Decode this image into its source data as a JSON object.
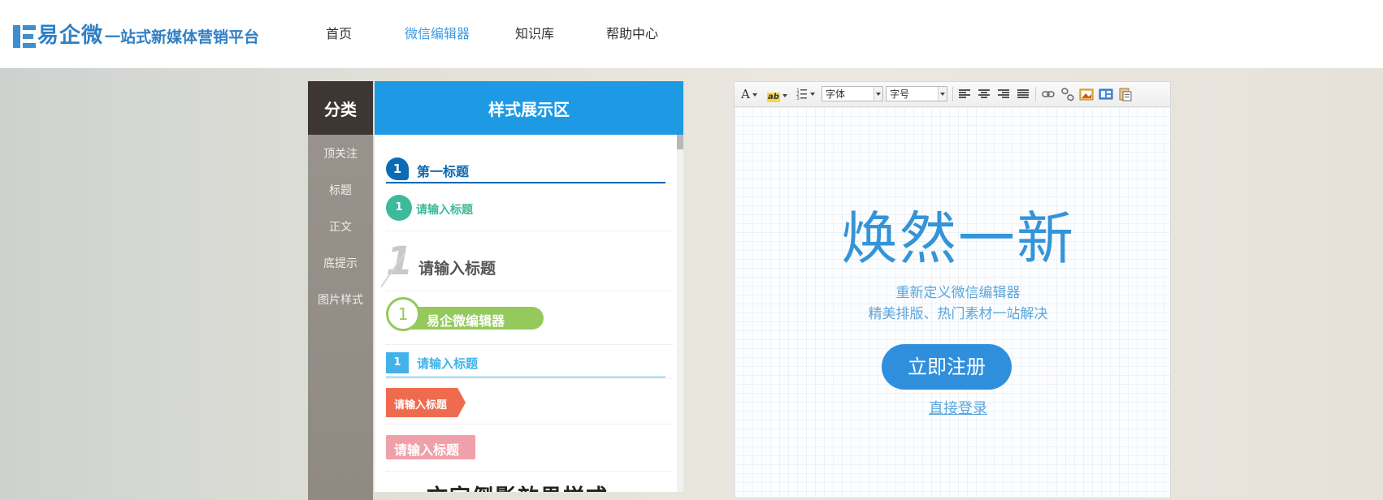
{
  "header": {
    "logo_name": "易企微",
    "logo_slogan": "一站式新媒体营销平台",
    "nav": [
      "首页",
      "微信编辑器",
      "知识库",
      "帮助中心"
    ],
    "active_nav": "微信编辑器"
  },
  "categories": {
    "title": "分类",
    "items": [
      "顶关注",
      "标题",
      "正文",
      "底提示",
      "图片样式"
    ]
  },
  "showcase": {
    "title": "样式展示区",
    "styles": [
      {
        "number": "1",
        "text": "第一标题"
      },
      {
        "number": "1",
        "text": "请输入标题"
      },
      {
        "number": "1",
        "text": "请输入标题"
      },
      {
        "number": "1",
        "text": "易企微编辑器"
      },
      {
        "number": "1",
        "text": "请输入标题"
      },
      {
        "text": "请输入标题"
      },
      {
        "text": "请输入标题"
      },
      {
        "text": "文字倒影效果样式"
      }
    ]
  },
  "editor": {
    "toolbar": {
      "font_color_label": "A",
      "highlight_label": "ab",
      "font_family_placeholder": "字体",
      "font_size_placeholder": "字号"
    },
    "hero_title": "焕然一新",
    "hero_line1": "重新定义微信编辑器",
    "hero_line2": "精美排版、热门素材一站解决",
    "register_label": "立即注册",
    "login_label": "直接登录"
  },
  "colors": {
    "brand": "#2e7fc4",
    "accent": "#1e9ae4",
    "category_header": "#3e3633",
    "register_button": "#2f8fdc"
  },
  "icons": [
    "logo-e-icon",
    "font-color-icon",
    "highlight-icon",
    "list-icon",
    "align-left-icon",
    "align-center-icon",
    "align-right-icon",
    "align-justify-icon",
    "link-icon",
    "unlink-icon",
    "image-icon",
    "template-icon",
    "paste-icon"
  ]
}
